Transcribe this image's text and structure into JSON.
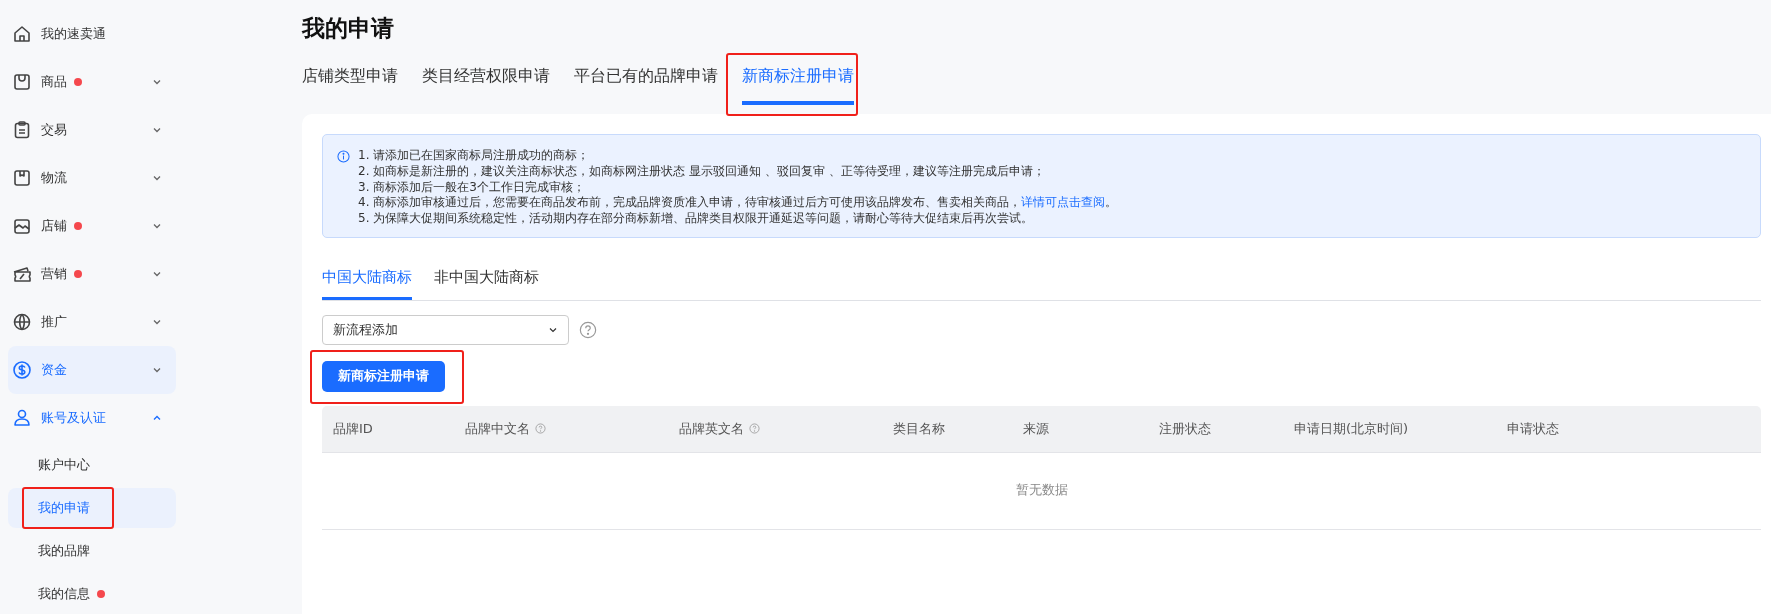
{
  "sidebar": {
    "items": [
      {
        "label": "我的速卖通",
        "dot": false,
        "kind": "link",
        "active": false
      },
      {
        "label": "商品",
        "dot": true,
        "kind": "group",
        "active": false,
        "expanded": false
      },
      {
        "label": "交易",
        "dot": false,
        "kind": "group",
        "active": false,
        "expanded": false
      },
      {
        "label": "物流",
        "dot": false,
        "kind": "group",
        "active": false,
        "expanded": false
      },
      {
        "label": "店铺",
        "dot": true,
        "kind": "group",
        "active": false,
        "expanded": false
      },
      {
        "label": "营销",
        "dot": true,
        "kind": "group",
        "active": false,
        "expanded": false
      },
      {
        "label": "推广",
        "dot": false,
        "kind": "group",
        "active": false,
        "expanded": false
      },
      {
        "label": "资金",
        "dot": false,
        "kind": "group",
        "active": true,
        "expanded": false
      },
      {
        "label": "账号及认证",
        "dot": false,
        "kind": "group",
        "active": false,
        "expanded": true,
        "children": [
          {
            "label": "账户中心",
            "selected": false,
            "dot": false,
            "highlighted": false
          },
          {
            "label": "我的申请",
            "selected": true,
            "dot": false,
            "highlighted": true
          },
          {
            "label": "我的品牌",
            "selected": false,
            "dot": false,
            "highlighted": false
          },
          {
            "label": "我的信息",
            "selected": false,
            "dot": true,
            "highlighted": false
          }
        ]
      }
    ]
  },
  "page": {
    "title": "我的申请"
  },
  "tabs": [
    {
      "label": "店铺类型申请",
      "selected": false,
      "highlighted": false
    },
    {
      "label": "类目经营权限申请",
      "selected": false,
      "highlighted": false
    },
    {
      "label": "平台已有的品牌申请",
      "selected": false,
      "highlighted": false
    },
    {
      "label": "新商标注册申请",
      "selected": true,
      "highlighted": true
    }
  ],
  "notice": {
    "lines": [
      {
        "text": "1. 请添加已在国家商标局注册成功的商标；"
      },
      {
        "text": "2. 如商标是新注册的，建议关注商标状态，如商标网注册状态 显示驳回通知 、驳回复审 、正等待受理，建议等注册完成后申请；"
      },
      {
        "text": "3. 商标添加后一般在3个工作日完成审核；"
      },
      {
        "text": "4. 商标添加审核通过后，您需要在商品发布前，完成品牌资质准入申请，待审核通过后方可使用该品牌发布、售卖相关商品，",
        "link": "详情可点击查阅",
        "after": "。"
      },
      {
        "text": "5. 为保障大促期间系统稳定性，活动期内存在部分商标新增、品牌类目权限开通延迟等问题，请耐心等待大促结束后再次尝试。"
      }
    ]
  },
  "sub_tabs": [
    {
      "label": "中国大陆商标",
      "selected": true
    },
    {
      "label": "非中国大陆商标",
      "selected": false
    }
  ],
  "mode_select": {
    "value": "新流程添加"
  },
  "primary_button": {
    "label": "新商标注册申请",
    "highlighted": true
  },
  "table": {
    "columns": [
      {
        "label": "品牌ID",
        "help": false
      },
      {
        "label": "品牌中文名",
        "help": true
      },
      {
        "label": "品牌英文名",
        "help": true
      },
      {
        "label": "类目名称",
        "help": false
      },
      {
        "label": "来源",
        "help": false
      },
      {
        "label": "注册状态",
        "help": false
      },
      {
        "label": "申请日期(北京时间)",
        "help": false
      },
      {
        "label": "申请状态",
        "help": false
      }
    ],
    "empty_text": "暂无数据"
  }
}
